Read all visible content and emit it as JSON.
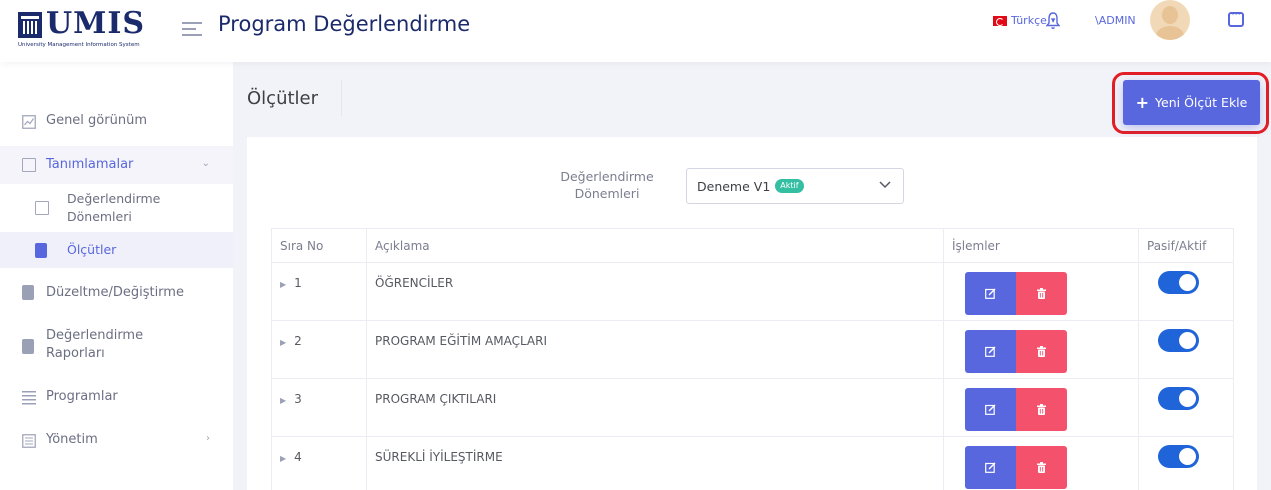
{
  "header": {
    "logo_text": "UMIS",
    "logo_subtitle": "University Management Information System",
    "title": "Program Değerlendirme",
    "language": "Türkçe",
    "user": "\\ADMIN",
    "icons": [
      "menu-icon",
      "flag-tr-icon",
      "bell-icon",
      "avatar",
      "chat-icon"
    ]
  },
  "sidebar": {
    "items": [
      {
        "label": "Genel görünüm",
        "icon": "chart-icon"
      },
      {
        "label": "Tanımlamalar",
        "icon": "folder-icon",
        "expanded": true
      },
      {
        "label": "Değerlendirme Dönemleri",
        "icon": "folder-icon"
      },
      {
        "label": "Ölçütler",
        "icon": "document-icon",
        "active": true
      },
      {
        "label": "Düzeltme/Değiştirme",
        "icon": "document-icon"
      },
      {
        "label": "Değerlendirme Raporları",
        "icon": "document-icon"
      },
      {
        "label": "Programlar",
        "icon": "list-icon"
      },
      {
        "label": "Yönetim",
        "icon": "settings-icon"
      }
    ]
  },
  "page": {
    "title": "Ölçütler",
    "add_button": "Yeni Ölçüt Ekle"
  },
  "filter": {
    "label": "Değerlendirme Dönemleri",
    "selected": "Deneme V1",
    "badge": "Aktif"
  },
  "table": {
    "columns": [
      "Sıra No",
      "Açıklama",
      "İşlemler",
      "Pasif/Aktif"
    ],
    "rows": [
      {
        "no": "1",
        "description": "ÖĞRENCİLER",
        "active": true
      },
      {
        "no": "2",
        "description": "PROGRAM EĞİTİM AMAÇLARI",
        "active": true
      },
      {
        "no": "3",
        "description": "PROGRAM ÇIKTILARI",
        "active": true
      },
      {
        "no": "4",
        "description": "SÜREKLİ İYİLEŞTİRME",
        "active": true
      }
    ]
  },
  "colors": {
    "primary": "#5867dd",
    "danger": "#f4516c",
    "success_badge": "#34bfa3",
    "toggle_on": "#1f64d9",
    "highlight": "#e31e24"
  }
}
